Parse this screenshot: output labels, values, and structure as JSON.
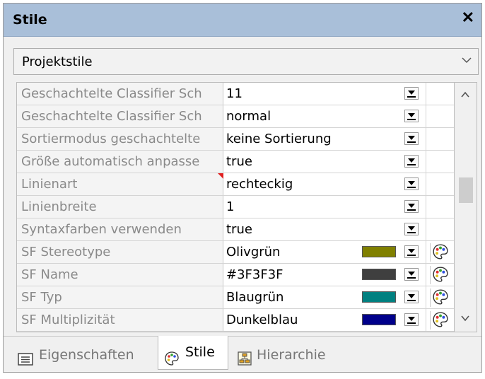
{
  "window": {
    "title": "Stile",
    "close_label": "✕"
  },
  "scope_select": {
    "selected": "Projektstile"
  },
  "properties": [
    {
      "name": "Geschachtelte Classifier Sch",
      "value": "11"
    },
    {
      "name": "Geschachtelte Classifier Sch",
      "value": "normal"
    },
    {
      "name": "Sortiermodus geschachtelte",
      "value": "keine Sortierung"
    },
    {
      "name": "Größe automatisch anpasse",
      "value": "true"
    },
    {
      "name": "Linienart",
      "value": "rechteckig"
    },
    {
      "name": "Linienbreite",
      "value": "1"
    },
    {
      "name": "Syntaxfarben verwenden",
      "value": "true"
    },
    {
      "name": "SF Stereotype",
      "value": "Olivgrün",
      "color": "#808000"
    },
    {
      "name": "SF Name",
      "value": "#3F3F3F",
      "color": "#3F3F3F"
    },
    {
      "name": "SF Typ",
      "value": "Blaugrün",
      "color": "#008080"
    },
    {
      "name": "SF Multiplizität",
      "value": "Dunkelblau",
      "color": "#00008B"
    }
  ],
  "tabs": [
    {
      "label": "Eigenschaften",
      "icon": "properties-icon"
    },
    {
      "label": "Stile",
      "icon": "palette-icon",
      "active": true
    },
    {
      "label": "Hierarchie",
      "icon": "hierarchy-icon"
    }
  ],
  "colors": {
    "titlebar": "#a9bfd9",
    "marker": "#e02020"
  }
}
